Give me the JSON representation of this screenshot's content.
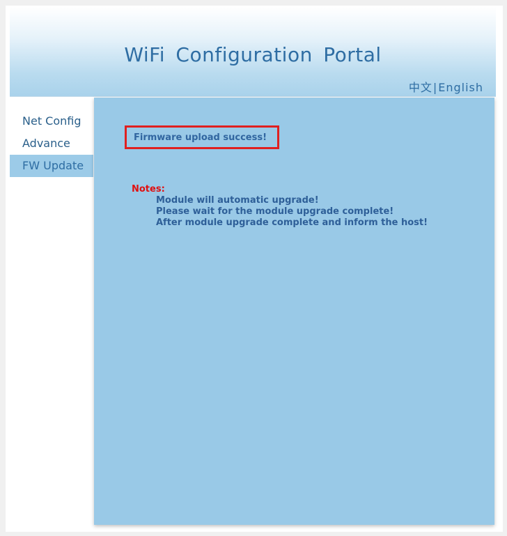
{
  "header": {
    "title": "WiFi  Configuration  Portal",
    "lang_chinese": "中文",
    "lang_separator": "|",
    "lang_english": "English"
  },
  "sidebar": {
    "items": [
      {
        "label": "Net Config",
        "active": false
      },
      {
        "label": "Advance",
        "active": false
      },
      {
        "label": "FW Update",
        "active": true
      }
    ]
  },
  "main": {
    "success_message": "Firmware upload success!",
    "notes_title": "Notes:",
    "notes": [
      "Module will automatic upgrade!",
      "Please wait for the module upgrade complete!",
      "After module upgrade complete and inform the host!"
    ]
  },
  "colors": {
    "content_background": "#99c9e7",
    "accent_text": "#2e6da3",
    "highlight_border": "#e02020",
    "notes_title": "#e01010"
  }
}
